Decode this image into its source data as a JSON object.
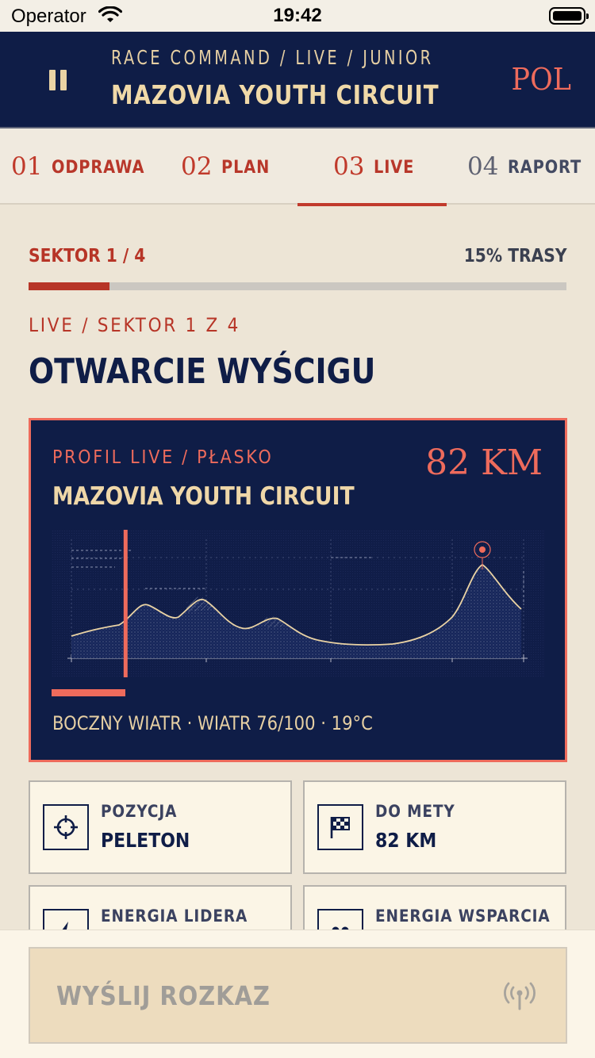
{
  "status_bar": {
    "carrier": "Operator",
    "time": "19:42"
  },
  "header": {
    "eyebrow": "RACE COMMAND / LIVE / JUNIOR",
    "title": "MAZOVIA YOUTH CIRCUIT",
    "country": "POL"
  },
  "tabs": [
    {
      "num": "01",
      "label": "ODPRAWA",
      "active": false
    },
    {
      "num": "02",
      "label": "PLAN",
      "active": false
    },
    {
      "num": "03",
      "label": "LIVE",
      "active": true
    },
    {
      "num": "04",
      "label": "RAPORT",
      "active": false
    }
  ],
  "progress": {
    "sector_label": "SEKTOR 1 / 4",
    "route_pct_label": "15% TRASY",
    "fraction": 0.15
  },
  "section": {
    "eyebrow": "LIVE / SEKTOR 1 Z 4",
    "title": "OTWARCIE WYŚCIGU"
  },
  "profile": {
    "eyebrow": "PROFIL LIVE / PŁASKO",
    "title": "MAZOVIA YOUTH CIRCUIT",
    "distance": "82 KM",
    "position_fraction": 0.15,
    "conditions": "BOCZNY WIATR · WIATR 76/100 · 19°C"
  },
  "stats": [
    {
      "label": "POZYCJA",
      "value": "PELETON",
      "icon": "crosshair-icon"
    },
    {
      "label": "DO METY",
      "value": "82 KM",
      "icon": "checkered-flag-icon"
    },
    {
      "label": "ENERGIA LIDERA",
      "value": "",
      "icon": "lightning-icon"
    },
    {
      "label": "ENERGIA WSPARCIA",
      "value": "",
      "icon": "team-icon"
    }
  ],
  "action": {
    "label": "WYŚLIJ ROZKAZ",
    "icon": "antenna-icon"
  },
  "colors": {
    "navy": "#0f1d47",
    "accent": "#ee6b5c",
    "red": "#b73527",
    "cream": "#ede5d6",
    "gold": "#efd7a8"
  }
}
